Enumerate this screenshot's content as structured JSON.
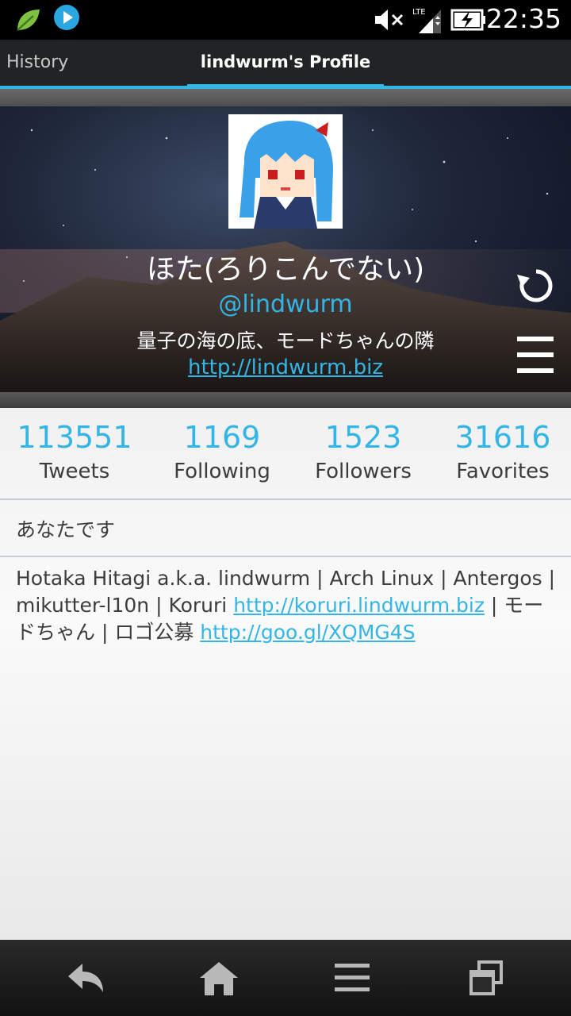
{
  "status_bar": {
    "time": "22:35",
    "icons": [
      "leaf-icon",
      "play-icon",
      "mute-icon",
      "lte-signal-icon",
      "battery-charging-icon"
    ]
  },
  "tabs": {
    "history": "History",
    "profile": "lindwurm's Profile"
  },
  "profile": {
    "display_name": "ほた(ろりこんでない)",
    "handle": "@lindwurm",
    "location": "量子の海の底、モードちゃんの隣",
    "website": "http://lindwurm.biz"
  },
  "stats": [
    {
      "value": "113551",
      "label": "Tweets"
    },
    {
      "value": "1169",
      "label": "Following"
    },
    {
      "value": "1523",
      "label": "Followers"
    },
    {
      "value": "31616",
      "label": "Favorites"
    }
  ],
  "you_label": "あなたです",
  "bio": {
    "text1": "Hotaka Hitagi a.k.a. lindwurm | Arch Linux | Antergos | mikutter-l10n | Koruri ",
    "link1": "http://koruri.lindwurm.biz",
    "text2": " | モードちゃん | ロゴ公募 ",
    "link2": "http://goo.gl/XQMG4S"
  },
  "colors": {
    "accent": "#33b5e5",
    "text": "#3c3c3c",
    "tabbar": "#222325"
  }
}
